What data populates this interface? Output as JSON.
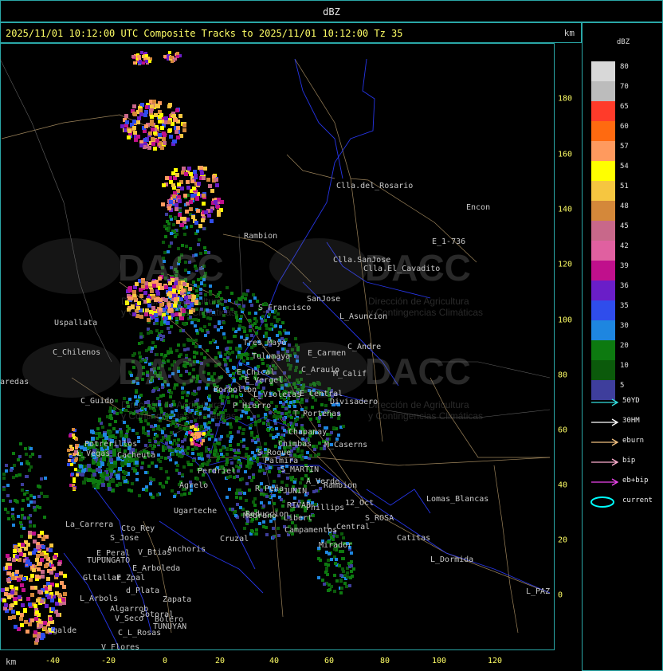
{
  "window": {
    "title": "dBZ"
  },
  "header": {
    "text": "2025/11/01 10:12:00 UTC Composite Tracks to 2025/11/01 10:12:00 Tz 35",
    "km_label": "km"
  },
  "axes": {
    "x_label": "km",
    "x_ticks": [
      "-40",
      "-20",
      "0",
      "20",
      "40",
      "60",
      "80",
      "100",
      "120"
    ],
    "y_ticks": [
      "180",
      "160",
      "140",
      "120",
      "100",
      "80",
      "60",
      "40",
      "20",
      "0"
    ],
    "grid": false
  },
  "legend": {
    "title": "dBZ",
    "levels": [
      {
        "label": "80",
        "color": "#d8d8d8"
      },
      {
        "label": "70",
        "color": "#bcbcbc"
      },
      {
        "label": "65",
        "color": "#ff3b2a"
      },
      {
        "label": "60",
        "color": "#ff6a10"
      },
      {
        "label": "57",
        "color": "#ff9a5e"
      },
      {
        "label": "54",
        "color": "#ffff00"
      },
      {
        "label": "51",
        "color": "#f6c640"
      },
      {
        "label": "48",
        "color": "#d4883a"
      },
      {
        "label": "45",
        "color": "#c8688a"
      },
      {
        "label": "42",
        "color": "#e060a0"
      },
      {
        "label": "39",
        "color": "#c0108c"
      },
      {
        "label": "36",
        "color": "#6a1ec8"
      },
      {
        "label": "35",
        "color": "#2f4dec"
      },
      {
        "label": "30",
        "color": "#1e86e0"
      },
      {
        "label": "20",
        "color": "#0d7a10"
      },
      {
        "label": "10",
        "color": "#0b5a0b"
      },
      {
        "label": "5",
        "color": "#3e3e9c"
      }
    ],
    "tracks": [
      {
        "label": "50YD",
        "color": "#33dddd"
      },
      {
        "label": "30HM",
        "color": "#ffffff"
      },
      {
        "label": "eburn",
        "color": "#f0c080"
      },
      {
        "label": "bip",
        "color": "#ffb0d0"
      },
      {
        "label": "eb+bip",
        "color": "#ee44ee"
      },
      {
        "label": "current",
        "color": "#00ffff"
      }
    ]
  },
  "watermark": {
    "brand": "DACC",
    "line1": "Dirección de Agricultura",
    "line2": "y Contingencias Climáticas"
  },
  "places": [
    "Clla.del_Rosario",
    "Encon",
    "E_1-736",
    "Rambion",
    "Clla.SanJose",
    "Clla.El_Cavadito",
    "Uspallata",
    "S_Francisco",
    "SanJose",
    "L_Asuncion",
    "C_Chilenos",
    "Tres_Mayo",
    "C_Andre",
    "Tulumaya",
    "E_Carmen",
    "E_Chical",
    "C_Arauio",
    "M_Calif",
    "E_Vergel",
    "Borbollon",
    "E_Central",
    "Divisadero",
    "C_Guido",
    "L_Violetas",
    "P_Hierro",
    "T_Porteñas",
    "Chapanay",
    "Chimbas",
    "M_Caserns",
    "Potrerillos",
    "L_Vegas",
    "Cacheuta",
    "S_Roque",
    "Palmira",
    "S_MARTIN",
    "A_Verde",
    "Perdriel",
    "Agrelo",
    "Rambion",
    "R_Peña",
    "JUNIN",
    "Ugarteche",
    "Medrano",
    "RIVAD",
    "Phillips",
    "12_Oct",
    "S_ROSA",
    "Lomas_Blancas",
    "La_Carrera",
    "Cto_Rey",
    "Reduccion",
    "Libert",
    "Campamentos",
    "L_Central",
    "S_Jose",
    "Anchoris",
    "Cruzal",
    "Catitas",
    "E_Peral",
    "V_Btias",
    "TUPUNGATO",
    "Mirador",
    "L_Dormida",
    "E_Arboleda",
    "Gltallar",
    "E_Zpal",
    "d_Plata",
    "L_Arbols",
    "Zapata",
    "L_PAZ",
    "Algarrob",
    "V_Seco",
    "Sotoral",
    "Bolero",
    "TUNUYAN",
    "C_L_Rosas",
    "V_Flores",
    "aredas",
    "Ugalde"
  ]
}
